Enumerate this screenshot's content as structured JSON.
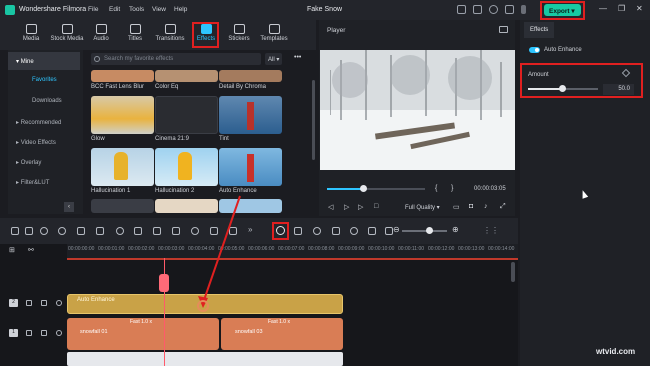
{
  "app": {
    "name": "Wondershare Filmora",
    "project_title": "Fake Snow",
    "menu": [
      "File",
      "Edit",
      "Tools",
      "View",
      "Help"
    ],
    "export_label": "Export",
    "accent_color": "#2ec5ff",
    "brand_color": "#17c9a3",
    "highlight_color": "#e02020"
  },
  "media_tabs": [
    {
      "label": "Media",
      "icon": "media-icon"
    },
    {
      "label": "Stock Media",
      "icon": "stock-media-icon"
    },
    {
      "label": "Audio",
      "icon": "audio-icon"
    },
    {
      "label": "Titles",
      "icon": "titles-icon"
    },
    {
      "label": "Transitions",
      "icon": "transitions-icon"
    },
    {
      "label": "Effects",
      "icon": "effects-icon",
      "active": true
    },
    {
      "label": "Stickers",
      "icon": "stickers-icon"
    },
    {
      "label": "Templates",
      "icon": "templates-icon"
    }
  ],
  "nav": {
    "mine": "Mine",
    "favorites": "Favorites",
    "downloads": "Downloads",
    "recommended": "Recommended",
    "video_effects": "Video Effects",
    "overlay": "Overlay",
    "filter_lut": "Filter&LUT"
  },
  "effects_browser": {
    "search_placeholder": "Search my favorite effects",
    "filter_value": "All",
    "items": [
      {
        "label": "BCC Fast Lens Blur"
      },
      {
        "label": "Color Eq"
      },
      {
        "label": "Detail By Chroma"
      },
      {
        "label": "Glow"
      },
      {
        "label": "Cinema 21:9"
      },
      {
        "label": "Tint"
      },
      {
        "label": "Hallucination 1"
      },
      {
        "label": "Hallucination 2"
      },
      {
        "label": "Auto Enhance"
      }
    ]
  },
  "player": {
    "label": "Player",
    "timecode": "00:00:03:05",
    "quality": "Full Quality",
    "progress": 0.37
  },
  "properties": {
    "tab": "Effects",
    "auto_enhance_label": "Auto Enhance",
    "amount_label": "Amount",
    "amount_value": "50.0",
    "amount_level": 0.5
  },
  "timeline": {
    "ticks": [
      "00:00:00:00",
      "00:00:01:00",
      "00:00:02:00",
      "00:00:03:00",
      "00:00:04:00",
      "00:00:05:00",
      "00:00:06:00",
      "00:00:07:00",
      "00:00:08:00",
      "00:00:09:00",
      "00:00:10:00",
      "00:00:11:00",
      "00:00:12:00",
      "00:00:13:00",
      "00:00:14:00"
    ],
    "effect_clip": "Auto Enhance",
    "video_clips": [
      {
        "name": "snowfall 01",
        "speed": "Fast 1.0 x"
      },
      {
        "name": "snowfall 03",
        "speed": "Fast 1.0 x"
      }
    ],
    "track_numbers": [
      "2",
      "1"
    ]
  },
  "watermark": "wtvid.com"
}
